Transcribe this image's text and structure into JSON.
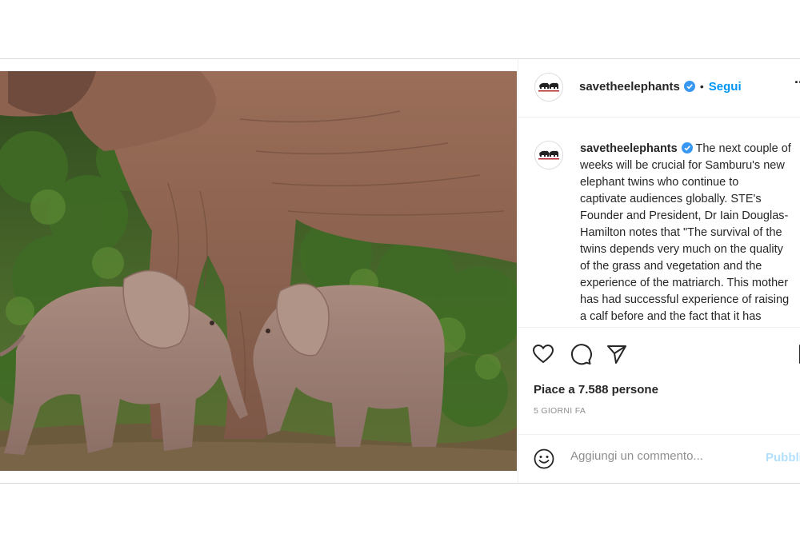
{
  "post": {
    "username": "savetheelephants",
    "verified": true,
    "follow_label": "Segui",
    "separator": "•",
    "more_label": "...",
    "caption_lines": [
      "The next couple of",
      "weeks will be crucial for Samburu's new",
      "elephant twins who continue to",
      "captivate audiences globally. STE's",
      "Founder and President, Dr Iain Douglas-",
      "Hamilton notes that \"The survival of the",
      "twins depends very much on the quality",
      "of the grass and vegetation and the",
      "experience of the matriarch. This mother",
      "has had successful experience of raising",
      "a calf before and the fact that it has"
    ],
    "likes_text": "Piace a 7.588 persone",
    "date_text": "5 GIORNI FA",
    "comment_placeholder": "Aggiungi un commento...",
    "publish_label": "Pubblica"
  },
  "icons": {
    "like": "heart-icon",
    "comment": "comment-icon",
    "share": "share-icon",
    "save": "bookmark-icon",
    "emoji": "emoji-icon",
    "verified": "verified-badge-icon"
  },
  "colors": {
    "link_blue": "#0095f6",
    "publish_disabled": "#b2dffc",
    "muted": "#8e8e8e",
    "text": "#262626"
  }
}
